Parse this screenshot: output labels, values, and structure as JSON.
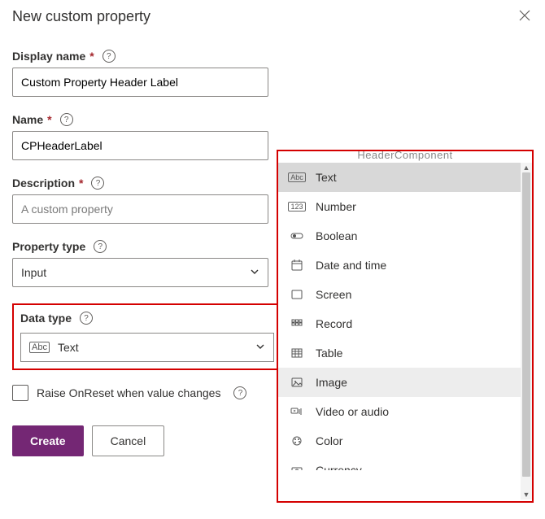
{
  "dialog": {
    "title": "New custom property",
    "close_label": "Close"
  },
  "fields": {
    "display_name": {
      "label": "Display name",
      "required": "*",
      "value": "Custom Property Header Label"
    },
    "name": {
      "label": "Name",
      "required": "*",
      "value": "CPHeaderLabel"
    },
    "description": {
      "label": "Description",
      "required": "*",
      "placeholder": "A custom property"
    },
    "property_type": {
      "label": "Property type",
      "value": "Input"
    },
    "data_type": {
      "label": "Data type",
      "value": "Text"
    },
    "raise_onreset": {
      "label": "Raise OnReset when value changes"
    }
  },
  "dropdown": {
    "partial_above": "HeaderComponent",
    "items": [
      {
        "label": "Text",
        "icon": "text-icon"
      },
      {
        "label": "Number",
        "icon": "number-icon"
      },
      {
        "label": "Boolean",
        "icon": "boolean-icon"
      },
      {
        "label": "Date and time",
        "icon": "datetime-icon"
      },
      {
        "label": "Screen",
        "icon": "screen-icon"
      },
      {
        "label": "Record",
        "icon": "record-icon"
      },
      {
        "label": "Table",
        "icon": "table-icon"
      },
      {
        "label": "Image",
        "icon": "image-icon"
      },
      {
        "label": "Video or audio",
        "icon": "media-icon"
      },
      {
        "label": "Color",
        "icon": "color-icon"
      },
      {
        "label": "Currency",
        "icon": "currency-icon"
      }
    ],
    "selected_index": 0,
    "hover_index": 7
  },
  "buttons": {
    "create": "Create",
    "cancel": "Cancel"
  }
}
